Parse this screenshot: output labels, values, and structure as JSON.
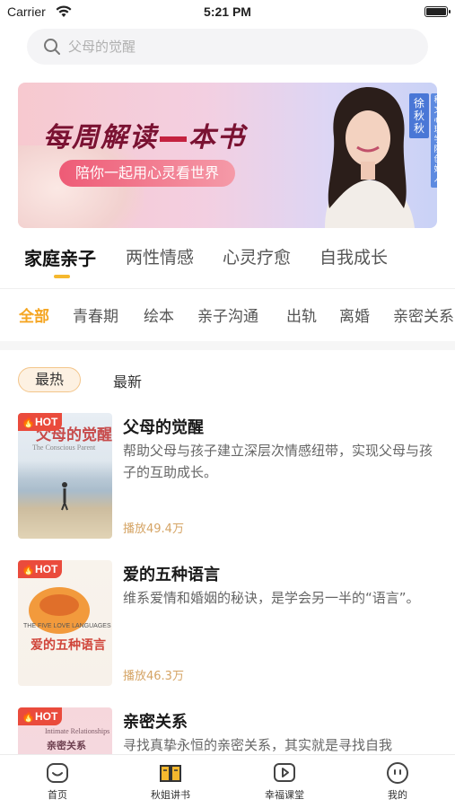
{
  "status_bar": {
    "carrier": "Carrier",
    "time": "5:21 PM"
  },
  "search": {
    "placeholder": "父母的觉醒"
  },
  "banner": {
    "title_part1": "每周解读",
    "title_part2": "本书",
    "subtitle": "陪你一起用心灵看世界",
    "name": "徐秋秋",
    "role": "秋文心理学院创始人"
  },
  "category_tabs": [
    {
      "label": "家庭亲子",
      "active": true
    },
    {
      "label": "两性情感",
      "active": false
    },
    {
      "label": "心灵疗愈",
      "active": false
    },
    {
      "label": "自我成长",
      "active": false
    }
  ],
  "sub_tabs": [
    {
      "label": "全部",
      "active": true
    },
    {
      "label": "青春期"
    },
    {
      "label": "绘本"
    },
    {
      "label": "亲子沟通"
    },
    {
      "label": "出轨"
    },
    {
      "label": "离婚"
    },
    {
      "label": "亲密关系"
    }
  ],
  "sort": {
    "hot": "最热",
    "new": "最新"
  },
  "books": [
    {
      "tag": "HOT",
      "title": "父母的觉醒",
      "description": "帮助父母与孩子建立深层次情感纽带，实现父母与孩子的互助成长。",
      "plays": "播放49.4万",
      "cover_title": "父母的觉醒",
      "cover_subtitle": "The Conscious Parent"
    },
    {
      "tag": "HOT",
      "title": "爱的五种语言",
      "description": "维系爱情和婚姻的秘诀，是学会另一半的“语言”。",
      "plays": "播放46.3万",
      "cover_title": "爱的五种语言",
      "cover_subtitle": "THE FIVE LOVE LANGUAGES"
    },
    {
      "tag": "HOT",
      "title": "亲密关系",
      "description": "寻找真挚永恒的亲密关系，其实就是寻找自我",
      "plays": "",
      "cover_title": "亲密关系",
      "cover_subtitle": "Intimate Relationships"
    }
  ],
  "tab_bar": [
    {
      "label": "首页",
      "icon": "home-icon"
    },
    {
      "label": "秋姐讲书",
      "icon": "book-icon"
    },
    {
      "label": "幸福课堂",
      "icon": "play-icon"
    },
    {
      "label": "我的",
      "icon": "profile-icon"
    }
  ],
  "colors": {
    "accent": "#f5a623",
    "hot": "#ea4b3c",
    "plays": "#d5a465"
  }
}
